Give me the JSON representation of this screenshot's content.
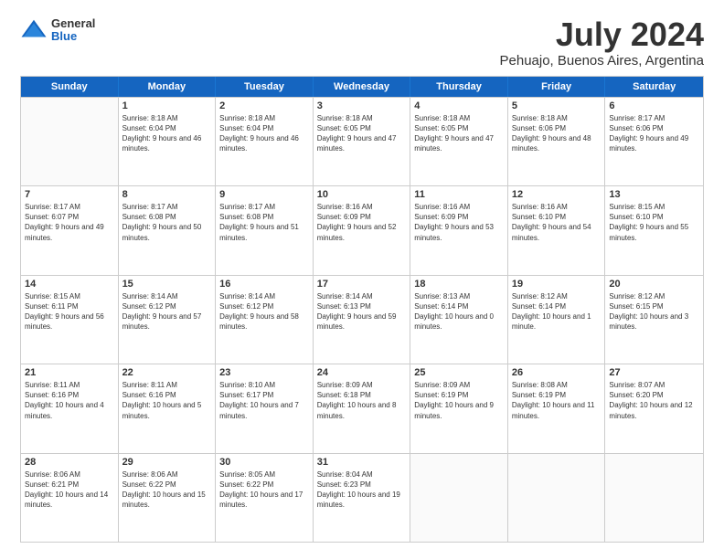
{
  "header": {
    "logo": {
      "general": "General",
      "blue": "Blue"
    },
    "title": "July 2024",
    "subtitle": "Pehuajo, Buenos Aires, Argentina"
  },
  "calendar": {
    "days": [
      "Sunday",
      "Monday",
      "Tuesday",
      "Wednesday",
      "Thursday",
      "Friday",
      "Saturday"
    ],
    "weeks": [
      [
        {
          "day": "",
          "empty": true
        },
        {
          "day": "1",
          "sunrise": "8:18 AM",
          "sunset": "6:04 PM",
          "daylight": "9 hours and 46 minutes."
        },
        {
          "day": "2",
          "sunrise": "8:18 AM",
          "sunset": "6:04 PM",
          "daylight": "9 hours and 46 minutes."
        },
        {
          "day": "3",
          "sunrise": "8:18 AM",
          "sunset": "6:05 PM",
          "daylight": "9 hours and 47 minutes."
        },
        {
          "day": "4",
          "sunrise": "8:18 AM",
          "sunset": "6:05 PM",
          "daylight": "9 hours and 47 minutes."
        },
        {
          "day": "5",
          "sunrise": "8:18 AM",
          "sunset": "6:06 PM",
          "daylight": "9 hours and 48 minutes."
        },
        {
          "day": "6",
          "sunrise": "8:17 AM",
          "sunset": "6:06 PM",
          "daylight": "9 hours and 49 minutes."
        }
      ],
      [
        {
          "day": "7",
          "sunrise": "8:17 AM",
          "sunset": "6:07 PM",
          "daylight": "9 hours and 49 minutes."
        },
        {
          "day": "8",
          "sunrise": "8:17 AM",
          "sunset": "6:08 PM",
          "daylight": "9 hours and 50 minutes."
        },
        {
          "day": "9",
          "sunrise": "8:17 AM",
          "sunset": "6:08 PM",
          "daylight": "9 hours and 51 minutes."
        },
        {
          "day": "10",
          "sunrise": "8:16 AM",
          "sunset": "6:09 PM",
          "daylight": "9 hours and 52 minutes."
        },
        {
          "day": "11",
          "sunrise": "8:16 AM",
          "sunset": "6:09 PM",
          "daylight": "9 hours and 53 minutes."
        },
        {
          "day": "12",
          "sunrise": "8:16 AM",
          "sunset": "6:10 PM",
          "daylight": "9 hours and 54 minutes."
        },
        {
          "day": "13",
          "sunrise": "8:15 AM",
          "sunset": "6:10 PM",
          "daylight": "9 hours and 55 minutes."
        }
      ],
      [
        {
          "day": "14",
          "sunrise": "8:15 AM",
          "sunset": "6:11 PM",
          "daylight": "9 hours and 56 minutes."
        },
        {
          "day": "15",
          "sunrise": "8:14 AM",
          "sunset": "6:12 PM",
          "daylight": "9 hours and 57 minutes."
        },
        {
          "day": "16",
          "sunrise": "8:14 AM",
          "sunset": "6:12 PM",
          "daylight": "9 hours and 58 minutes."
        },
        {
          "day": "17",
          "sunrise": "8:14 AM",
          "sunset": "6:13 PM",
          "daylight": "9 hours and 59 minutes."
        },
        {
          "day": "18",
          "sunrise": "8:13 AM",
          "sunset": "6:14 PM",
          "daylight": "10 hours and 0 minutes."
        },
        {
          "day": "19",
          "sunrise": "8:12 AM",
          "sunset": "6:14 PM",
          "daylight": "10 hours and 1 minute."
        },
        {
          "day": "20",
          "sunrise": "8:12 AM",
          "sunset": "6:15 PM",
          "daylight": "10 hours and 3 minutes."
        }
      ],
      [
        {
          "day": "21",
          "sunrise": "8:11 AM",
          "sunset": "6:16 PM",
          "daylight": "10 hours and 4 minutes."
        },
        {
          "day": "22",
          "sunrise": "8:11 AM",
          "sunset": "6:16 PM",
          "daylight": "10 hours and 5 minutes."
        },
        {
          "day": "23",
          "sunrise": "8:10 AM",
          "sunset": "6:17 PM",
          "daylight": "10 hours and 7 minutes."
        },
        {
          "day": "24",
          "sunrise": "8:09 AM",
          "sunset": "6:18 PM",
          "daylight": "10 hours and 8 minutes."
        },
        {
          "day": "25",
          "sunrise": "8:09 AM",
          "sunset": "6:19 PM",
          "daylight": "10 hours and 9 minutes."
        },
        {
          "day": "26",
          "sunrise": "8:08 AM",
          "sunset": "6:19 PM",
          "daylight": "10 hours and 11 minutes."
        },
        {
          "day": "27",
          "sunrise": "8:07 AM",
          "sunset": "6:20 PM",
          "daylight": "10 hours and 12 minutes."
        }
      ],
      [
        {
          "day": "28",
          "sunrise": "8:06 AM",
          "sunset": "6:21 PM",
          "daylight": "10 hours and 14 minutes."
        },
        {
          "day": "29",
          "sunrise": "8:06 AM",
          "sunset": "6:22 PM",
          "daylight": "10 hours and 15 minutes."
        },
        {
          "day": "30",
          "sunrise": "8:05 AM",
          "sunset": "6:22 PM",
          "daylight": "10 hours and 17 minutes."
        },
        {
          "day": "31",
          "sunrise": "8:04 AM",
          "sunset": "6:23 PM",
          "daylight": "10 hours and 19 minutes."
        },
        {
          "day": "",
          "empty": true
        },
        {
          "day": "",
          "empty": true
        },
        {
          "day": "",
          "empty": true
        }
      ]
    ]
  }
}
